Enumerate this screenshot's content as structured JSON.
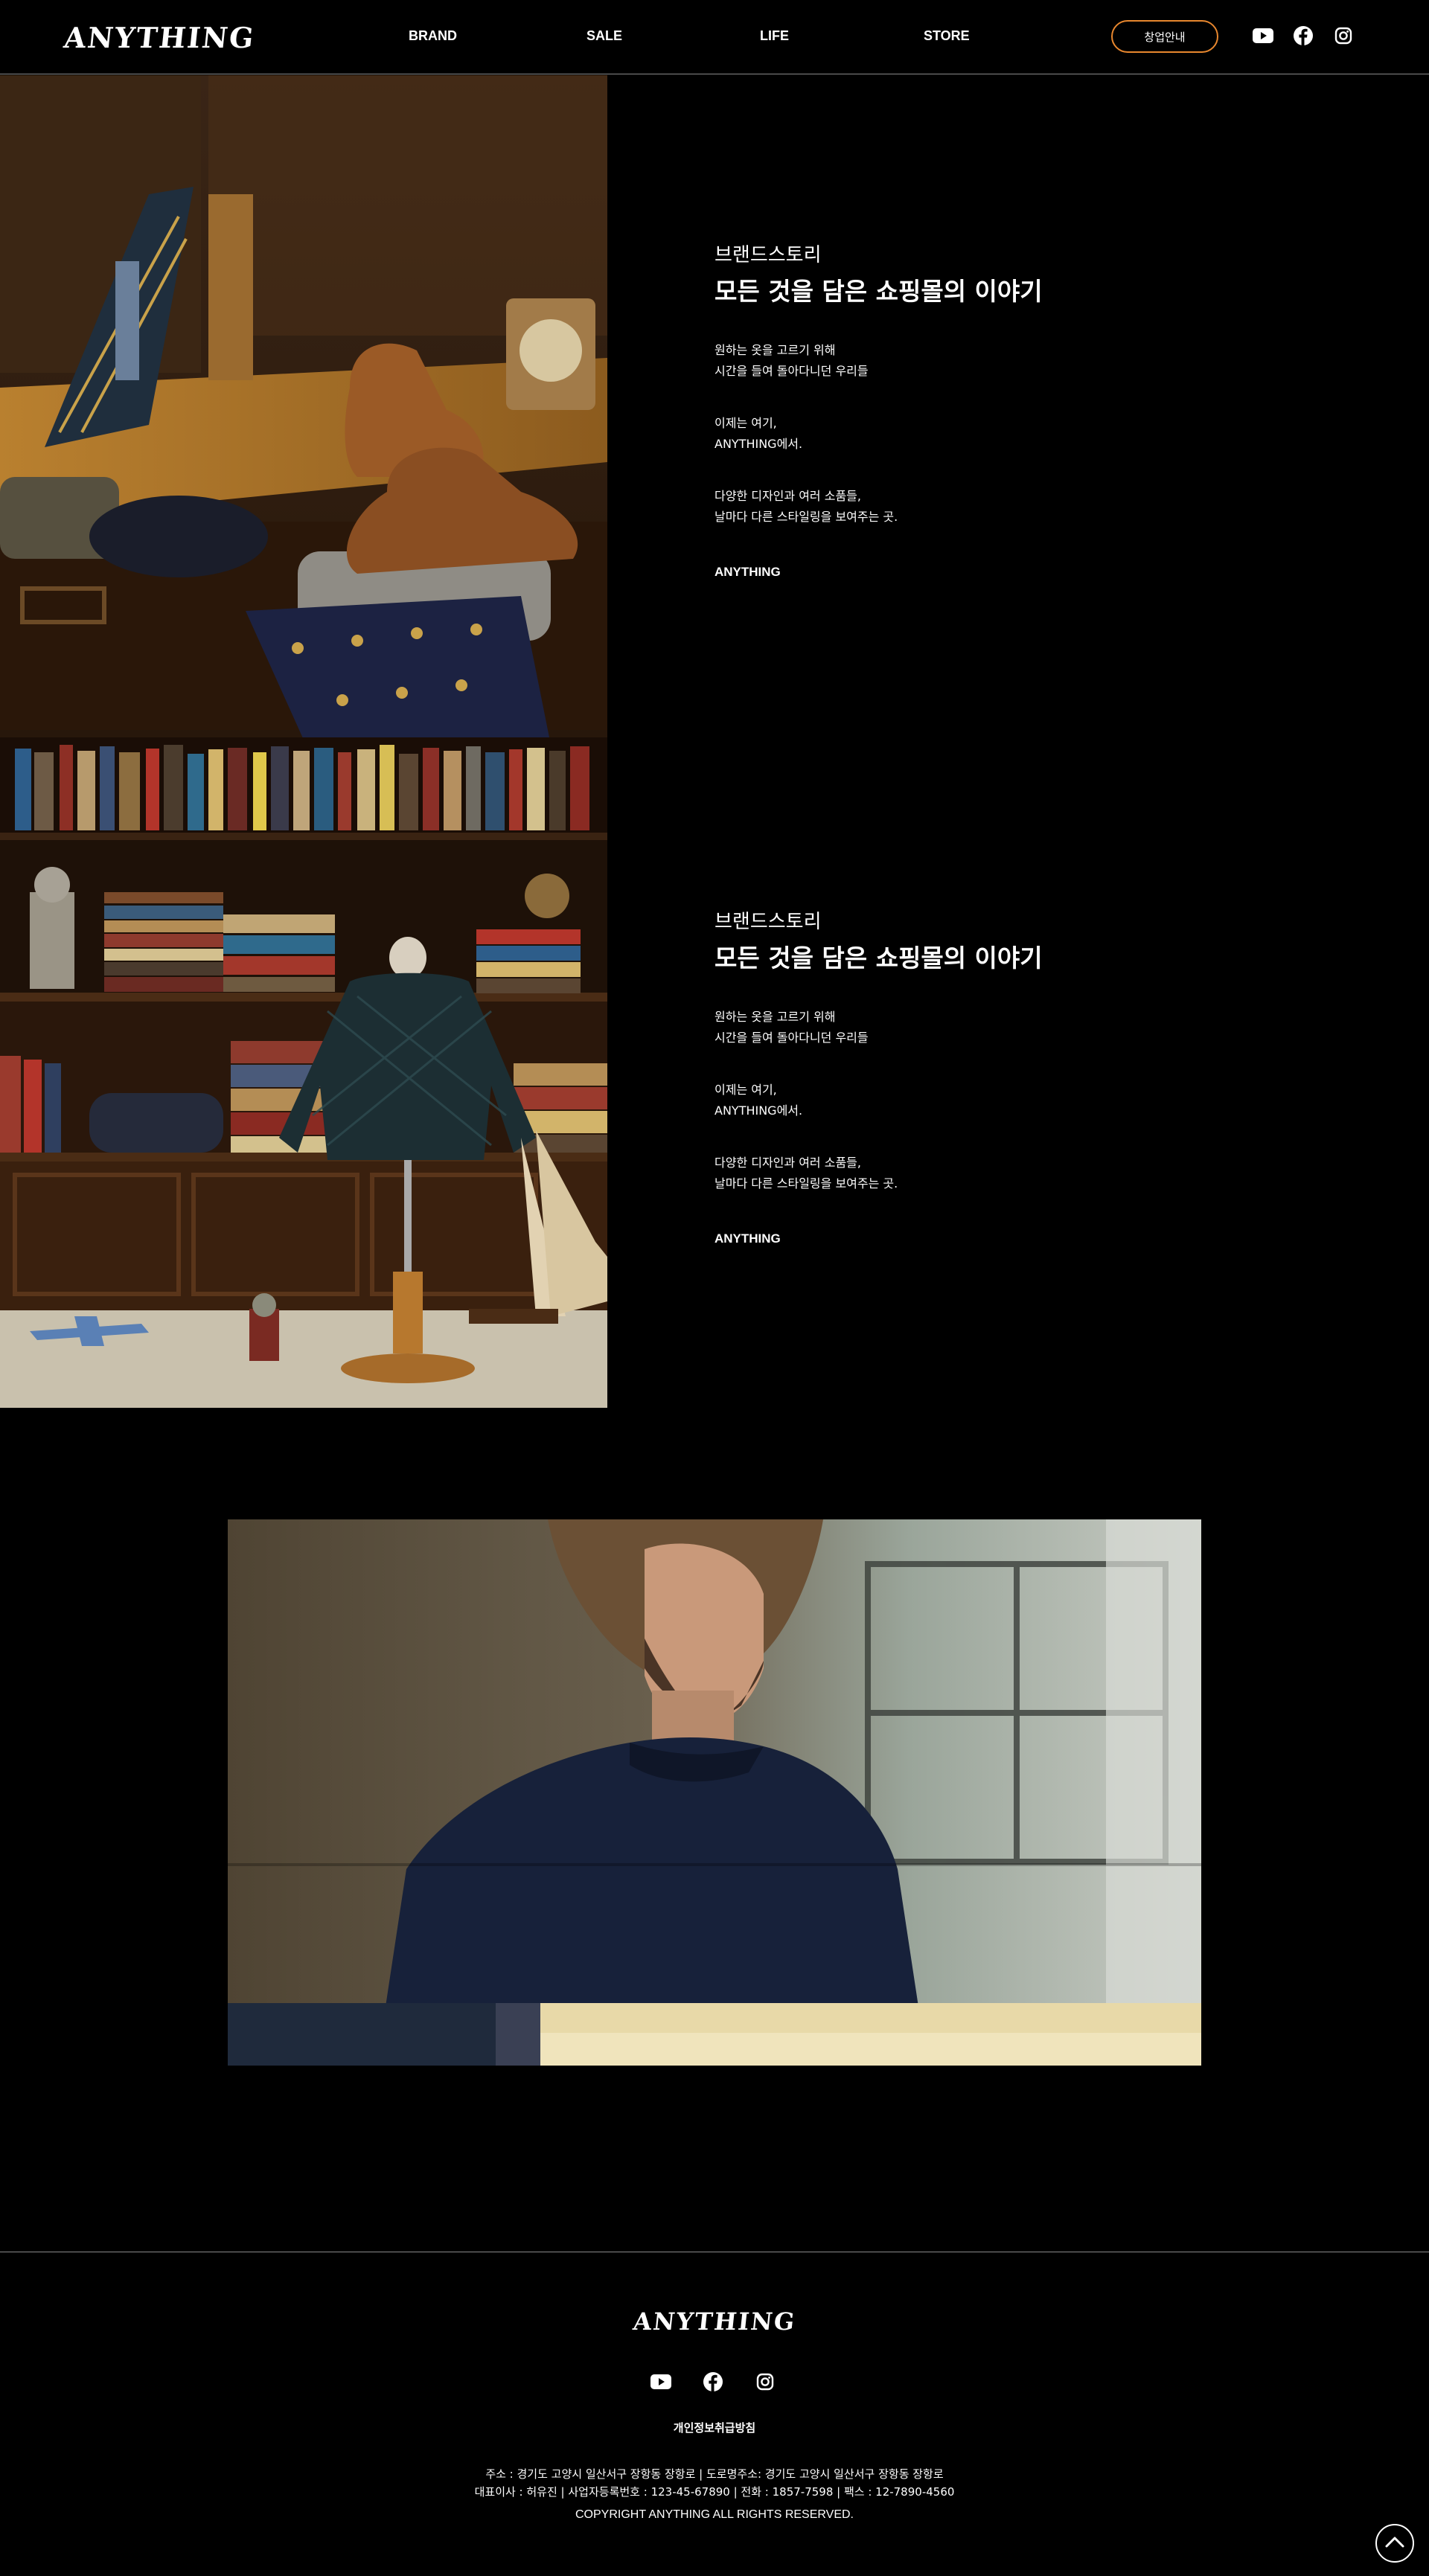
{
  "header": {
    "logo": "ANYTHING",
    "nav": [
      "BRAND",
      "SALE",
      "LIFE",
      "STORE"
    ],
    "franchise_button": "창업안내",
    "social_icons": [
      "youtube-icon",
      "facebook-icon",
      "instagram-icon"
    ]
  },
  "stories": [
    {
      "subtitle": "브랜드스토리",
      "title": "모든 것을 담은 쇼핑몰의 이야기",
      "p1_line1": "원하는 옷을 고르기 위해",
      "p1_line2": "시간을 들여 돌아다니던 우리들",
      "p2_line1": "이제는 여기,",
      "p2_line2": "ANYTHING에서.",
      "p3_line1": "다양한 디자인과 여러 소품들,",
      "p3_line2": "날마다 다른 스타일링을 보여주는 곳.",
      "brand": "ANYTHING"
    },
    {
      "subtitle": "브랜드스토리",
      "title": "모든 것을 담은 쇼핑몰의 이야기",
      "p1_line1": "원하는 옷을 고르기 위해",
      "p1_line2": "시간을 들여 돌아다니던 우리들",
      "p2_line1": "이제는 여기,",
      "p2_line2": "ANYTHING에서.",
      "p3_line1": "다양한 디자인과 여러 소품들,",
      "p3_line2": "날마다 다른 스타일링을 보여주는 곳.",
      "brand": "ANYTHING"
    }
  ],
  "footer": {
    "logo": "ANYTHING",
    "privacy": "개인정보취급방침",
    "address_line1": "주소 : 경기도 고양시 일산서구 장항동 장항로 | 도로명주소: 경기도 고양시 일산서구 장항동 장항로",
    "address_line2": "대표이사 : 허유진 | 사업자등록번호 : 123-45-67890 | 전화 : 1857-7598 | 팩스 : 12-7890-4560",
    "copyright": "COPYRIGHT ANYTHING ALL RIGHTS RESERVED."
  },
  "colors": {
    "background": "#000000",
    "accent_border": "#e8872e",
    "divider": "#8a8a8a"
  }
}
